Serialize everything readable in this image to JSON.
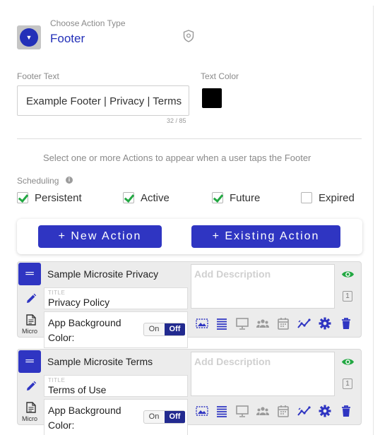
{
  "header": {
    "type_label": "Choose Action Type",
    "type_value": "Footer"
  },
  "footer_text": {
    "label": "Footer Text",
    "value": "Example Footer | Privacy | Terms",
    "counter": "32 / 85"
  },
  "text_color": {
    "label": "Text Color",
    "value": "#000000"
  },
  "helper_text": "Select one or more Actions to appear when a user taps the Footer",
  "scheduling": {
    "label": "Scheduling",
    "options": [
      {
        "label": "Persistent",
        "checked": true
      },
      {
        "label": "Active",
        "checked": true
      },
      {
        "label": "Future",
        "checked": true
      },
      {
        "label": "Expired",
        "checked": false
      }
    ]
  },
  "buttons": {
    "new_action": "+ New Action",
    "existing_action": "+ Existing Action"
  },
  "cards": [
    {
      "name": "Sample Microsite Privacy",
      "title_small": "TITLE",
      "title": "Privacy Policy",
      "micro_label": "Micro",
      "bg_label": "App Background Color:",
      "toggle_on": "On",
      "toggle_off": "Off",
      "description_placeholder": "Add Description",
      "order": "1"
    },
    {
      "name": "Sample Microsite Terms",
      "title_small": "TITLE",
      "title": "Terms of Use",
      "micro_label": "Micro",
      "bg_label": "App Background Color:",
      "toggle_on": "On",
      "toggle_off": "Off",
      "description_placeholder": "Add Description",
      "order": "1"
    }
  ],
  "colors": {
    "accent": "#2f35c2",
    "check": "#23a843",
    "eye": "#23a843"
  }
}
